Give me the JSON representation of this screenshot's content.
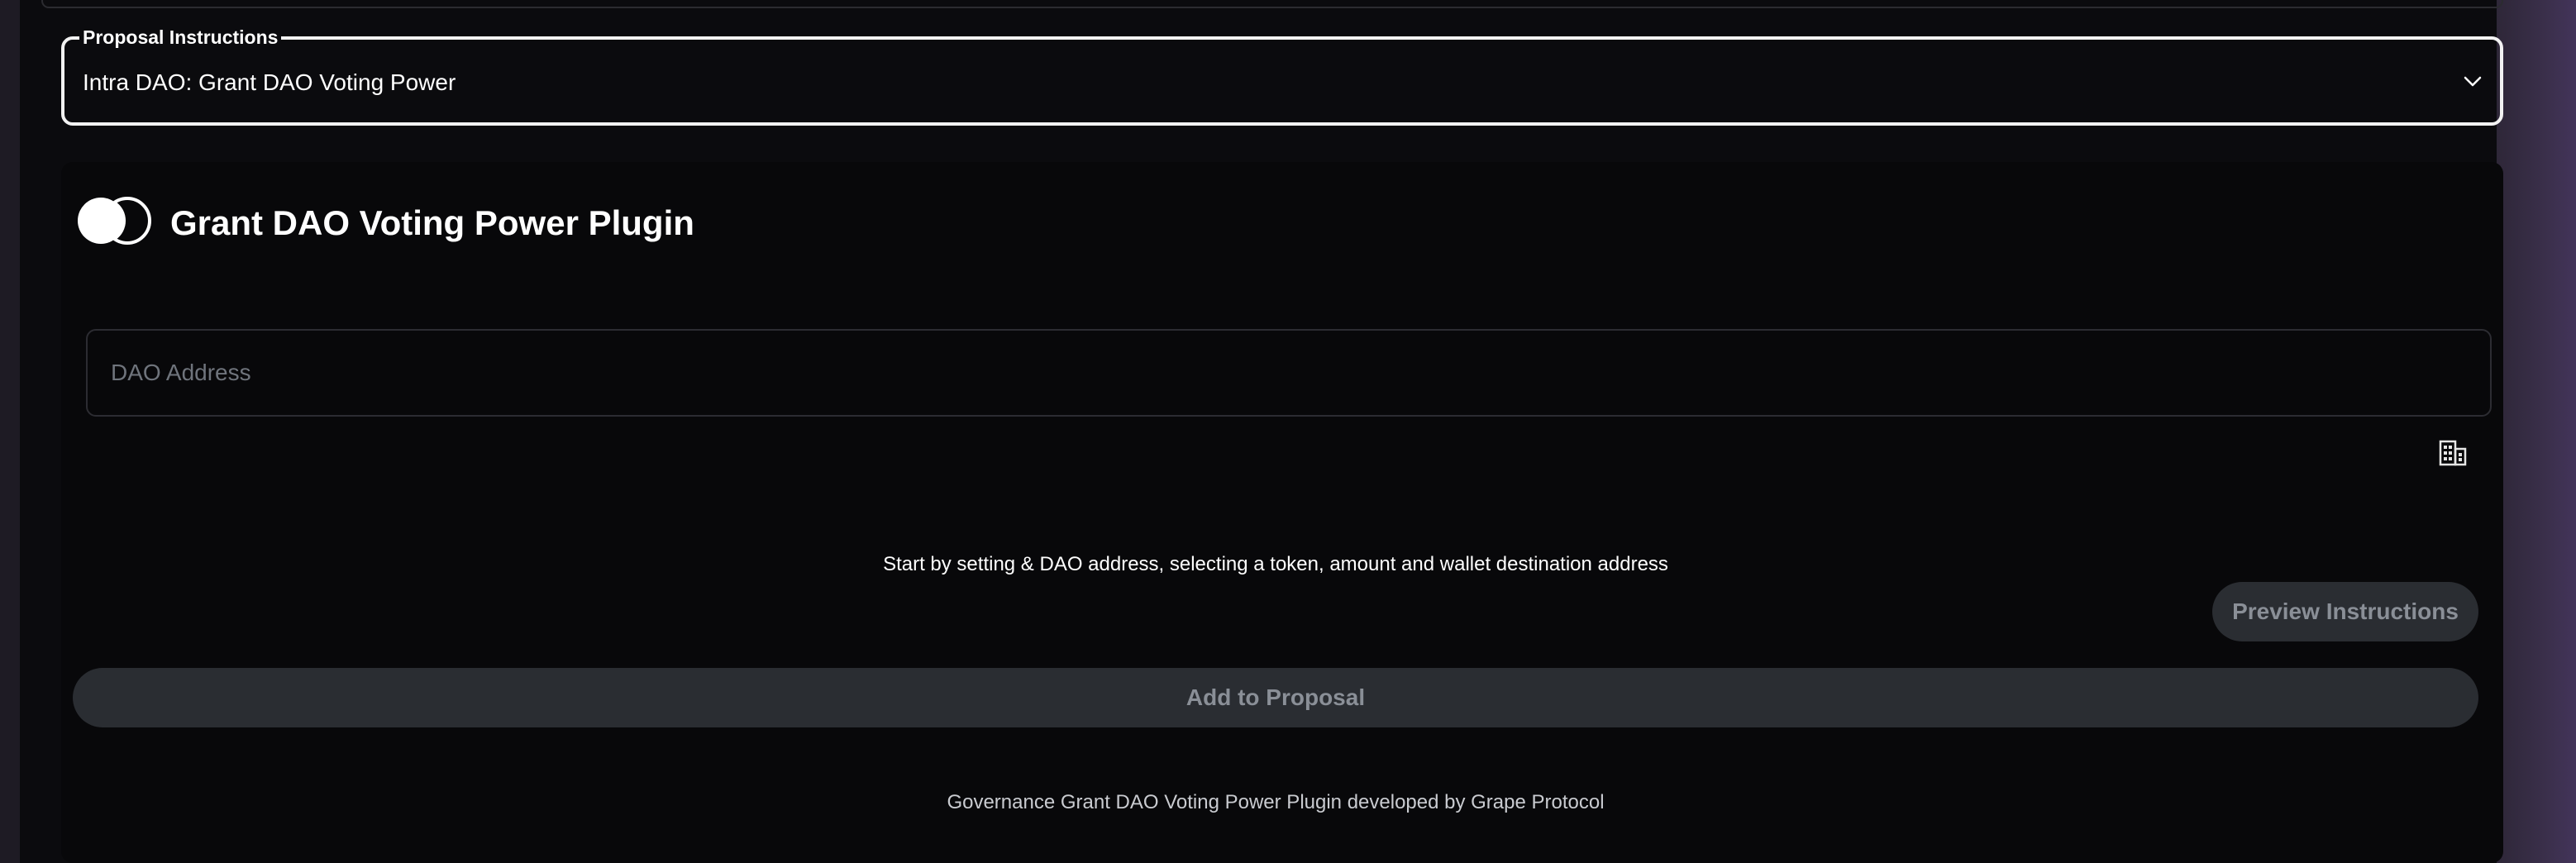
{
  "proposal_instructions": {
    "label": "Proposal Instructions",
    "selected_value": "Intra DAO: Grant DAO Voting Power"
  },
  "plugin": {
    "title": "Grant DAO Voting Power Plugin"
  },
  "dao_address": {
    "placeholder": "DAO Address",
    "value": ""
  },
  "hint": "Start by setting & DAO address, selecting a token, amount and wallet destination address",
  "buttons": {
    "preview": "Preview Instructions",
    "add_to_proposal": "Add to Proposal"
  },
  "footer": "Governance Grant DAO Voting Power Plugin developed by Grape Protocol",
  "icons": {
    "select": "chevron-down-icon",
    "logo": "plugin-logo-icon",
    "address_book": "building-icon"
  },
  "colors": {
    "background": "#0b0b0e",
    "text": "#ffffff",
    "muted_text": "#8a8f97",
    "button_bg": "#2a2d32",
    "select_border": "#f2f2f2"
  }
}
